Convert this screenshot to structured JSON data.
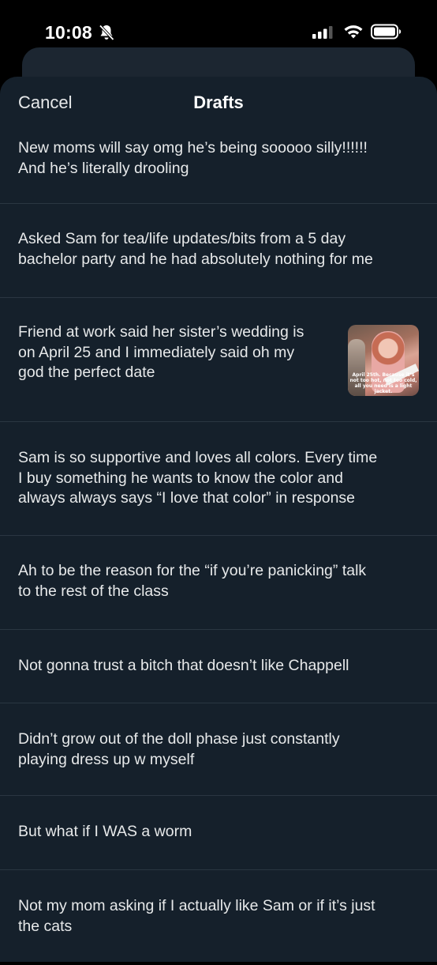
{
  "status_bar": {
    "time": "10:08",
    "icons": [
      "silent-bell-icon",
      "cellular-signal-icon",
      "wifi-icon",
      "battery-icon"
    ]
  },
  "header": {
    "cancel_label": "Cancel",
    "title": "Drafts"
  },
  "drafts": [
    {
      "text": "New moms will say omg he’s being sooooo silly!!!!!!\nAnd he’s literally drooling"
    },
    {
      "text": "Asked Sam for tea/life updates/bits from a 5 day\nbachelor party and he had absolutely nothing for me"
    },
    {
      "text": "Friend at work said her sister’s wedding is\non April 25 and I immediately said oh my\ngod the perfect date",
      "thumbnail_caption": "April 25th. Because it’s not too hot, not too cold, all you need is a light jacket."
    },
    {
      "text": "Sam is so supportive and loves all colors. Every time\nI buy something he wants to know the color and\nalways always says “I love that color” in response"
    },
    {
      "text": "Ah to be the reason for the “if you’re panicking” talk\nto the rest of the class"
    },
    {
      "text": "Not gonna trust a bitch that doesn’t like Chappell"
    },
    {
      "text": "Didn’t grow out of the doll phase just constantly\nplaying dress up w myself"
    },
    {
      "text": "But what if I WAS a worm"
    },
    {
      "text": "Not my mom asking if I actually like Sam or if it’s just\nthe cats"
    }
  ],
  "colors": {
    "sheet_background": "#15202b",
    "text": "#e7e9ea",
    "divider": "#2a3642"
  }
}
